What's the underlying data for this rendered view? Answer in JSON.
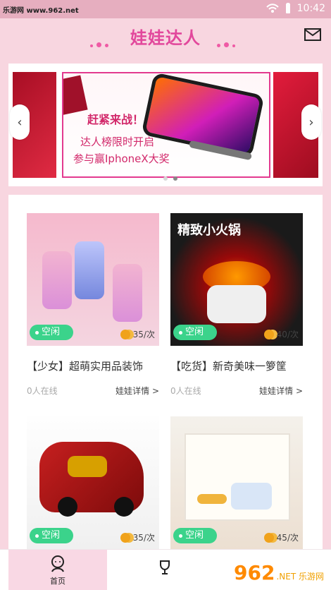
{
  "status": {
    "left_text": "乐游网 www.962.net",
    "time": "10:42"
  },
  "header": {
    "title": "娃娃达人",
    "mail_icon": "mail-icon"
  },
  "banner": {
    "line1": "赶紧来战！",
    "line2": "达人榜限时开启",
    "line3": "参与赢IphoneX大奖",
    "left_arrow": "‹",
    "right_arrow": "›"
  },
  "products": [
    {
      "status": "空闲",
      "price": "35/次",
      "title": "【少女】超萌实用品装饰",
      "online": "0人在线",
      "detail": "娃娃详情 >"
    },
    {
      "status": "空闲",
      "price": "40/次",
      "title": "【吃货】新奇美味一箩筐",
      "online": "0人在线",
      "detail": "娃娃详情 >",
      "cover_text": "精致小火锅"
    },
    {
      "status": "空闲",
      "price": "35/次",
      "title": "",
      "online": "",
      "detail": ""
    },
    {
      "status": "空闲",
      "price": "45/次",
      "title": "",
      "online": "",
      "detail": ""
    }
  ],
  "bottom_nav": {
    "home_label": "首页"
  },
  "watermark": {
    "bottom": "962",
    "bottom_small": ".NET 乐游网"
  }
}
